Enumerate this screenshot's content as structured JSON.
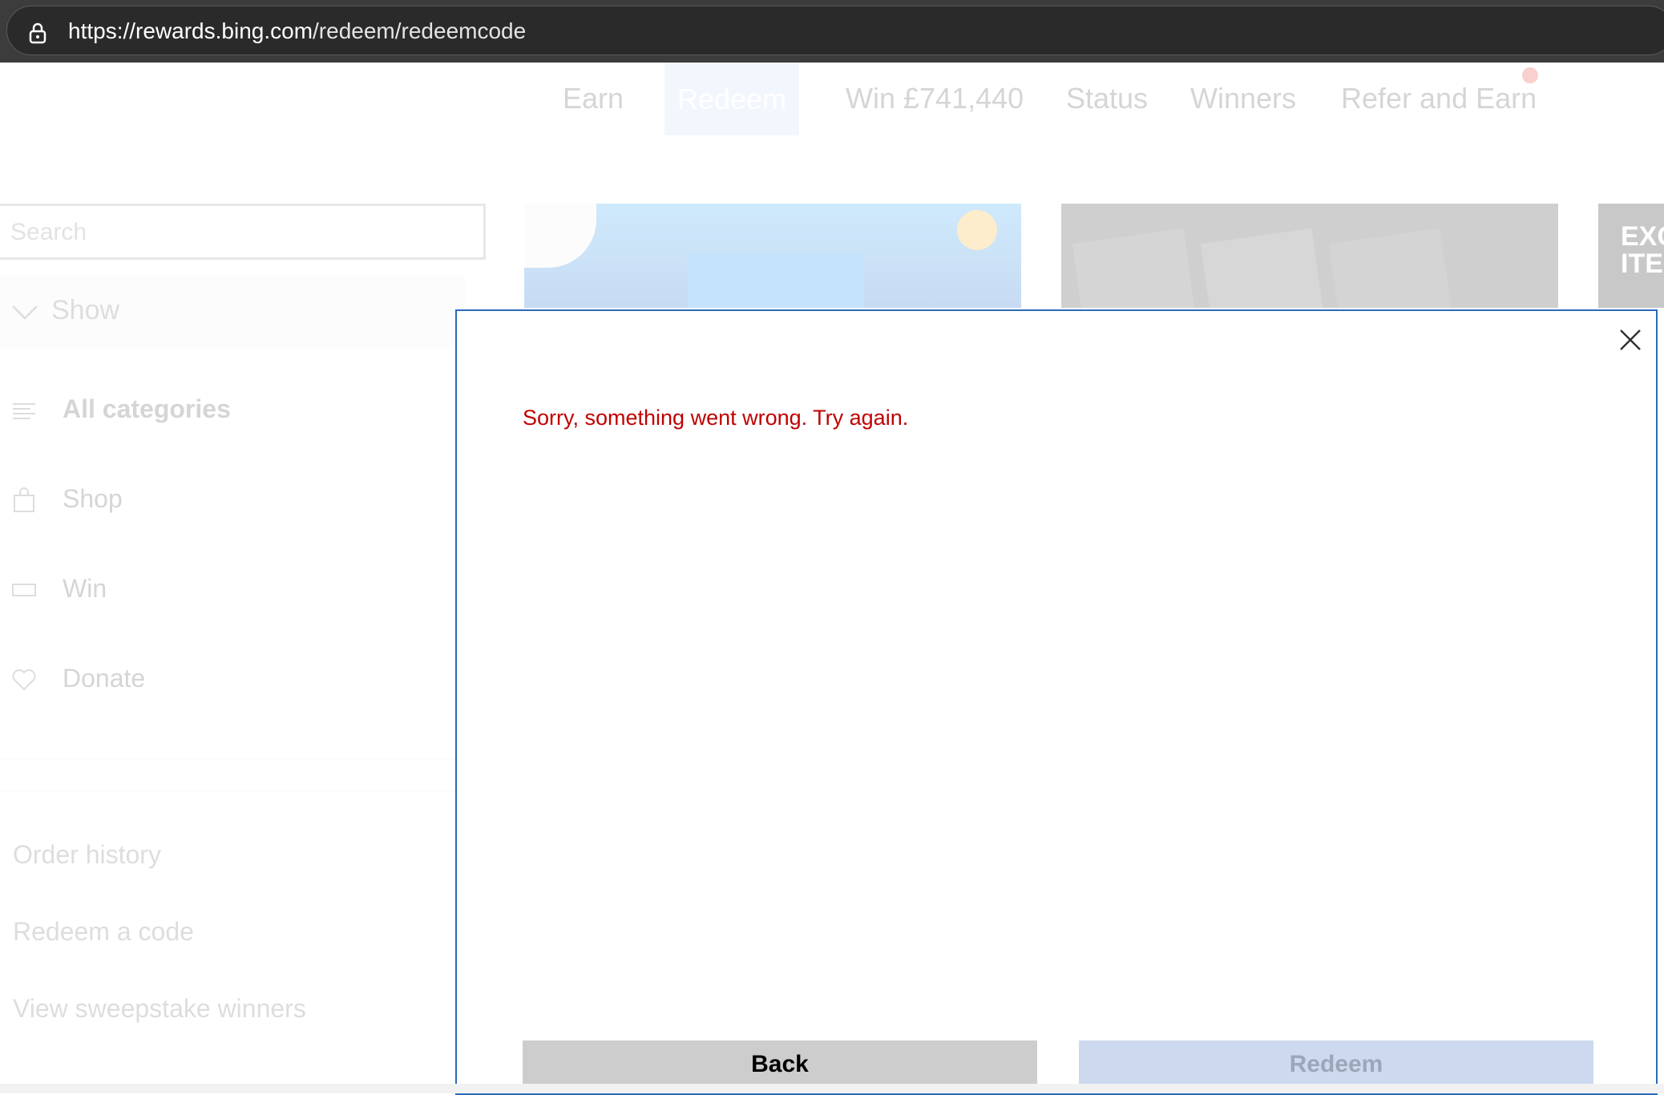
{
  "browser": {
    "url_host": "https://rewards.bing.com",
    "url_path": "/redeem/redeemcode"
  },
  "nav": {
    "items": [
      {
        "label": "Earn"
      },
      {
        "label": "Redeem",
        "active": true
      },
      {
        "label": "Win £741,440"
      },
      {
        "label": "Status"
      },
      {
        "label": "Winners"
      },
      {
        "label": "Refer and Earn"
      }
    ]
  },
  "sidebar": {
    "search_placeholder": "Search",
    "show_label": "Show",
    "categories": [
      {
        "label": "All categories",
        "icon": "list-icon"
      },
      {
        "label": "Shop",
        "icon": "shopping-bag-icon"
      },
      {
        "label": "Win",
        "icon": "ticket-icon"
      },
      {
        "label": "Donate",
        "icon": "heart-icon"
      }
    ],
    "links": [
      {
        "label": "Order history"
      },
      {
        "label": "Redeem a code"
      },
      {
        "label": "View sweepstake winners"
      }
    ]
  },
  "tiles": {
    "tile3_text_line1": "EXC",
    "tile3_text_line2": "ITE"
  },
  "modal": {
    "error_message": "Sorry, something went wrong. Try again.",
    "back_label": "Back",
    "redeem_label": "Redeem"
  },
  "colors": {
    "error": "#c00000",
    "modal_border": "#2b6bb8",
    "redeem_disabled": "#cdd9ee"
  }
}
